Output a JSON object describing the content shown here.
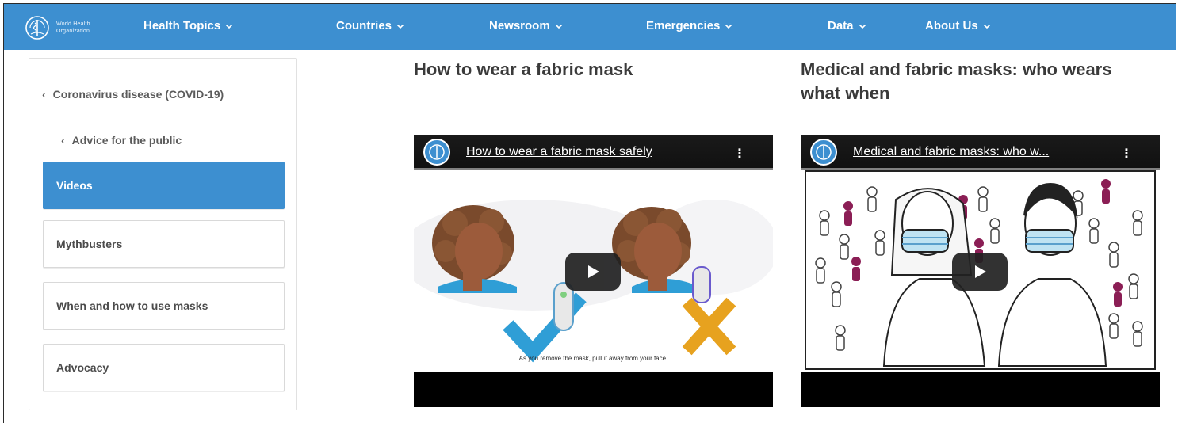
{
  "logo": {
    "line1": "World Health",
    "line2": "Organization"
  },
  "nav": {
    "items": [
      {
        "label": "Health Topics"
      },
      {
        "label": "Countries"
      },
      {
        "label": "Newsroom"
      },
      {
        "label": "Emergencies"
      },
      {
        "label": "Data"
      },
      {
        "label": "About Us"
      }
    ]
  },
  "sidebar": {
    "breadcrumb1": "Coronavirus disease (COVID-19)",
    "breadcrumb2": "Advice for the public",
    "items": [
      {
        "label": "Videos",
        "active": true
      },
      {
        "label": "Mythbusters"
      },
      {
        "label": "When and how to use masks"
      },
      {
        "label": "Advocacy"
      }
    ]
  },
  "articles": [
    {
      "title": "How to wear a fabric mask",
      "video_title": "How to wear a fabric mask safely",
      "caption": "As you remove the mask, pull it away from your face."
    },
    {
      "title": "Medical and fabric masks: who wears what when",
      "video_title": "Medical and fabric masks: who w..."
    }
  ],
  "colors": {
    "brand": "#3d8fd0",
    "check": "#2f9ed6",
    "cross": "#e7a21f",
    "figure_accent": "#8b1e55"
  }
}
